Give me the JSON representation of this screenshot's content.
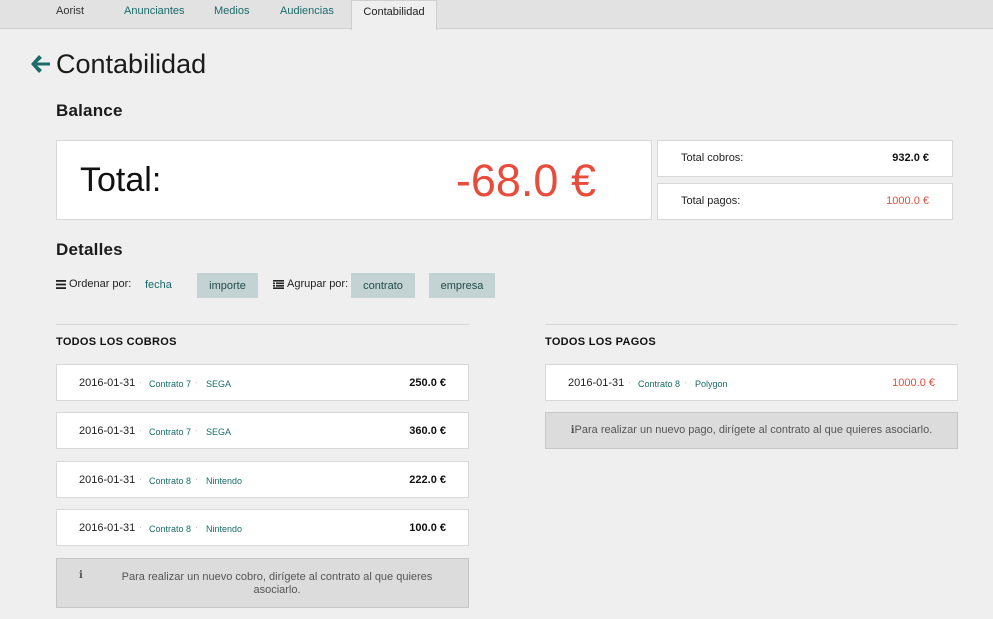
{
  "nav": {
    "brand": "Aorist",
    "links": [
      "Anunciantes",
      "Medios",
      "Audiencias"
    ],
    "active_tab": "Contabilidad"
  },
  "page": {
    "title": "Contabilidad",
    "back_icon": "arrow-left-icon"
  },
  "balance": {
    "title": "Balance",
    "total_label": "Total:",
    "total_value": "-68.0 €",
    "cobros_label": "Total cobros:",
    "cobros_value": "932.0 €",
    "pagos_label": "Total pagos:",
    "pagos_value": "1000.0 €"
  },
  "details": {
    "title": "Detalles",
    "sort_label": "Ordenar por:",
    "sort_options": [
      "fecha",
      "importe"
    ],
    "group_label": "Agrupar por:",
    "group_options": [
      "contrato",
      "empresa"
    ]
  },
  "cobros": {
    "title": "TODOS LOS COBROS",
    "items": [
      {
        "date": "2016-01-31",
        "contract": "Contrato 7",
        "company": "SEGA",
        "amount": "250.0 €"
      },
      {
        "date": "2016-01-31",
        "contract": "Contrato 7",
        "company": "SEGA",
        "amount": "360.0 €"
      },
      {
        "date": "2016-01-31",
        "contract": "Contrato 8",
        "company": "Nintendo",
        "amount": "222.0 €"
      },
      {
        "date": "2016-01-31",
        "contract": "Contrato 8",
        "company": "Nintendo",
        "amount": "100.0 €"
      }
    ],
    "info_line1": "Para realizar un nuevo cobro, dirígete al contrato al que quieres",
    "info_line2": "asociarlo."
  },
  "pagos": {
    "title": "TODOS LOS PAGOS",
    "items": [
      {
        "date": "2016-01-31",
        "contract": "Contrato 8",
        "company": "Polygon",
        "amount": "1000.0 €"
      }
    ],
    "info": "Para realizar un nuevo pago, dirígete al contrato al que quieres asociarlo."
  },
  "colors": {
    "accent": "#1a6b6b",
    "negative": "#e74c3c",
    "button": "#c3d3d3"
  }
}
